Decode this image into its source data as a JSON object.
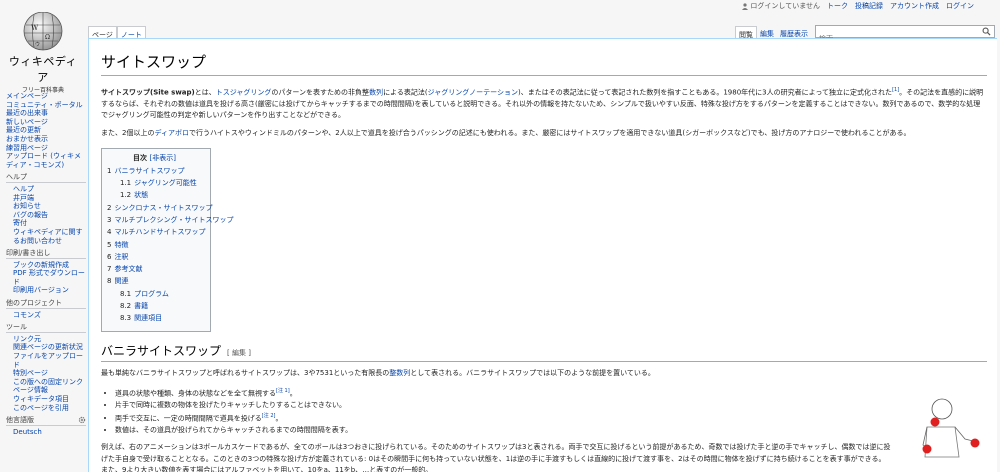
{
  "personal": {
    "not_logged_in": "ログインしていません",
    "talk": "トーク",
    "contributions": "投稿記録",
    "create_account": "アカウント作成",
    "login": "ログイン"
  },
  "logo": {
    "wordmark": "ウィキペディア",
    "tagline": "フリー百科事典"
  },
  "sidebar": {
    "main": [
      "メインページ",
      "コミュニティ・ポータル",
      "最近の出来事",
      "新しいページ",
      "最近の更新",
      "おまかせ表示",
      "練習用ページ",
      "アップロード (ウィキメディア・コモンズ)"
    ],
    "help": {
      "heading": "ヘルプ",
      "items": [
        "ヘルプ",
        "井戸端",
        "お知らせ",
        "バグの報告",
        "寄付",
        "ウィキペディアに関するお問い合わせ"
      ]
    },
    "print": {
      "heading": "印刷/書き出し",
      "items": [
        "ブックの新規作成",
        "PDF 形式でダウンロード",
        "印刷用バージョン"
      ]
    },
    "projects": {
      "heading": "他のプロジェクト",
      "items": [
        "コモンズ"
      ]
    },
    "tools": {
      "heading": "ツール",
      "items": [
        "リンク元",
        "関連ページの更新状況",
        "ファイルをアップロード",
        "特別ページ",
        "この版への固定リンク",
        "ページ情報",
        "ウィキデータ項目",
        "このページを引用"
      ]
    },
    "languages": {
      "heading": "他言語版",
      "items": [
        "Deutsch"
      ]
    }
  },
  "tabs": {
    "page": "ページ",
    "talk": "ノート",
    "read": "閲覧",
    "edit": "編集",
    "history": "履歴表示"
  },
  "search": {
    "placeholder": "検索"
  },
  "article": {
    "title": "サイトスワップ",
    "p1": {
      "bold": "サイトスワップ(Site swap)",
      "t1": "とは、",
      "l1": "トスジャグリング",
      "t2": "のパターンを表すための非負整",
      "l2": "数列",
      "t3": "による表記法(",
      "l3": "ジャグリングノーテーション",
      "t4": ")、またはその表記法に従って表記された数列を指すこともある。1980年代に3人の研究者によって独立に定式化された",
      "ref1": "[1]",
      "t5": "。その記法を直感的に説明するならば、それぞれの数値は道具を投げる高さ(厳密には投げてからキャッチするまでの時間間隔)を表していると説明できる。それ以外の情報を持たないため、シンプルで扱いやすい反面、特殊な投げ方をするパターンを定義することはできない。数列であるので、数学的な処理でジャグリング可能性の判定や新しいパターンを作り出すことなどができる。"
    },
    "p2": {
      "t1": "また、2個以上の",
      "l1": "ディアボロ",
      "t2": "で行うハイトスやウィンドミルのパターンや、2人以上で道具を投げ合うパッシングの記述にも使われる。また、厳密にはサイトスワップを適用できない道具(シガーボックスなど)でも、投げ方のアナロジーで使われることがある。"
    },
    "toc": {
      "title": "目次",
      "hide": "[非表示]",
      "entries": [
        {
          "num": "1",
          "label": "バニラサイトスワップ",
          "level": 1
        },
        {
          "num": "1.1",
          "label": "ジャグリング可能性",
          "level": 2
        },
        {
          "num": "1.2",
          "label": "状態",
          "level": 2
        },
        {
          "num": "2",
          "label": "シンクロナス・サイトスワップ",
          "level": 1
        },
        {
          "num": "3",
          "label": "マルチプレクシング・サイトスワップ",
          "level": 1
        },
        {
          "num": "4",
          "label": "マルチハンドサイトスワップ",
          "level": 1
        },
        {
          "num": "5",
          "label": "特徴",
          "level": 1
        },
        {
          "num": "6",
          "label": "注釈",
          "level": 1
        },
        {
          "num": "7",
          "label": "参考文献",
          "level": 1
        },
        {
          "num": "8",
          "label": "関連",
          "level": 1
        },
        {
          "num": "8.1",
          "label": "プログラム",
          "level": 2
        },
        {
          "num": "8.2",
          "label": "書籍",
          "level": 2
        },
        {
          "num": "8.3",
          "label": "関連項目",
          "level": 2
        }
      ]
    },
    "section1": {
      "heading": "バニラサイトスワップ",
      "edit": "[ 編集 ]",
      "intro": {
        "t1": "最も単純なバニラサイトスワップと呼ばれるサイトスワップは、3や7531といった有限長の",
        "l1": "整数列",
        "t2": "として表される。バニラサイトスワップでは以下のような前提を置いている。"
      },
      "bullets": [
        {
          "text": "道具の状態や種類、身体の状態などを全て無視する",
          "ref": "[注 1]",
          "tail": "。"
        },
        {
          "text": "片手で同時に複数の物体を投げたりキャッチしたりすることはできない。",
          "ref": "",
          "tail": ""
        },
        {
          "text": "両手で交互に、一定の時間間隔で道具を投げる",
          "ref": "[注 2]",
          "tail": "。"
        },
        {
          "text": "数値は、その道具が投げられてからキャッチされるまでの時間間隔を表す。",
          "ref": "",
          "tail": ""
        }
      ],
      "p3": "例えば、右のアニメーションは3ボールカスケードであるが、全てのボールは3つおきに投げられている。そのためのサイトスワップは3と表される。両手で交互に投げるという前提があるため、奇数では投げた手と逆の手でキャッチし、偶数では逆に投げた手自身で受け取ることとなる。このときの3つの特殊な投げ方が定義されている: 0はその瞬間手に何も持っていない状態を、1は逆の手に手渡すもしくは直線的に投げて渡す事を、2はその時間に物体を投げずに持ち続けることを表す事ができる。また、9より大きい数値を表す場合にはアルファベットを用いて、10をa、11をb、…と表すのが一般的。"
    }
  },
  "colors": {
    "link": "#0645ad",
    "ball": "#e02020",
    "content_border": "#a7d7f9"
  }
}
